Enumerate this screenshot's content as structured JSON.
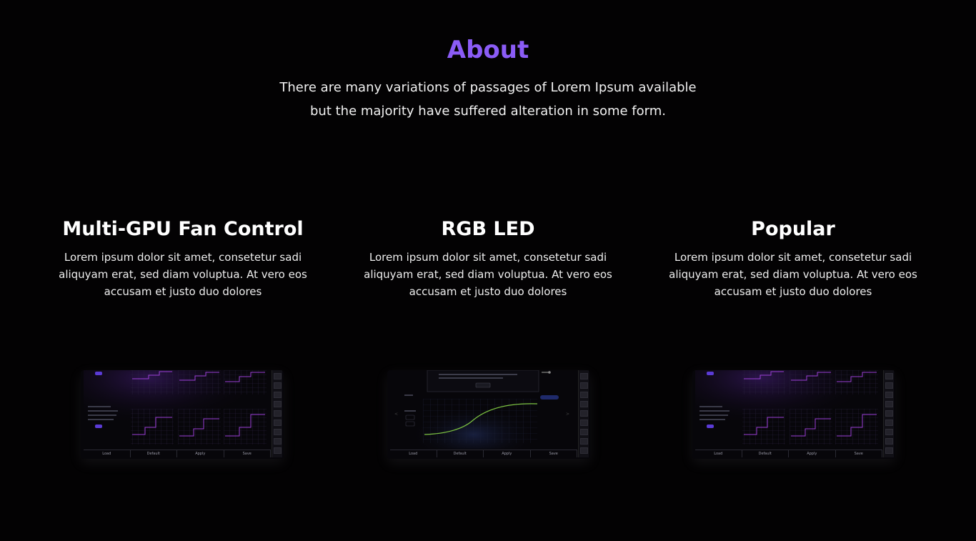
{
  "about": {
    "title": "About",
    "text_line1": "There are many variations of passages of Lorem Ipsum available",
    "text_line2": "but the majority have suffered alteration in some form."
  },
  "features": [
    {
      "title": "Multi-GPU Fan Control",
      "line1": "Lorem ipsum dolor sit amet, consetetur sadi",
      "line2": "aliquyam erat, sed diam voluptua. At vero eos",
      "line3": "accusam et justo duo dolores",
      "thumb_buttons": [
        "Load",
        "Default",
        "Apply",
        "Save"
      ]
    },
    {
      "title": "RGB LED",
      "line1": "Lorem ipsum dolor sit amet, consetetur sadi",
      "line2": "aliquyam erat, sed diam voluptua. At vero eos",
      "line3": "accusam et justo duo dolores",
      "thumb_buttons": [
        "Load",
        "Default",
        "Apply",
        "Save"
      ]
    },
    {
      "title": "Popular",
      "line1": "Lorem ipsum dolor sit amet, consetetur sadi",
      "line2": "aliquyam erat, sed diam voluptua. At vero eos",
      "line3": "accusam et justo duo dolores",
      "thumb_buttons": [
        "Load",
        "Default",
        "Apply",
        "Save"
      ]
    }
  ],
  "colors": {
    "background": "#030203",
    "accent": "#8b5cf6",
    "curve_green": "#7cc241",
    "graph_purple": "#9b3fd6"
  }
}
